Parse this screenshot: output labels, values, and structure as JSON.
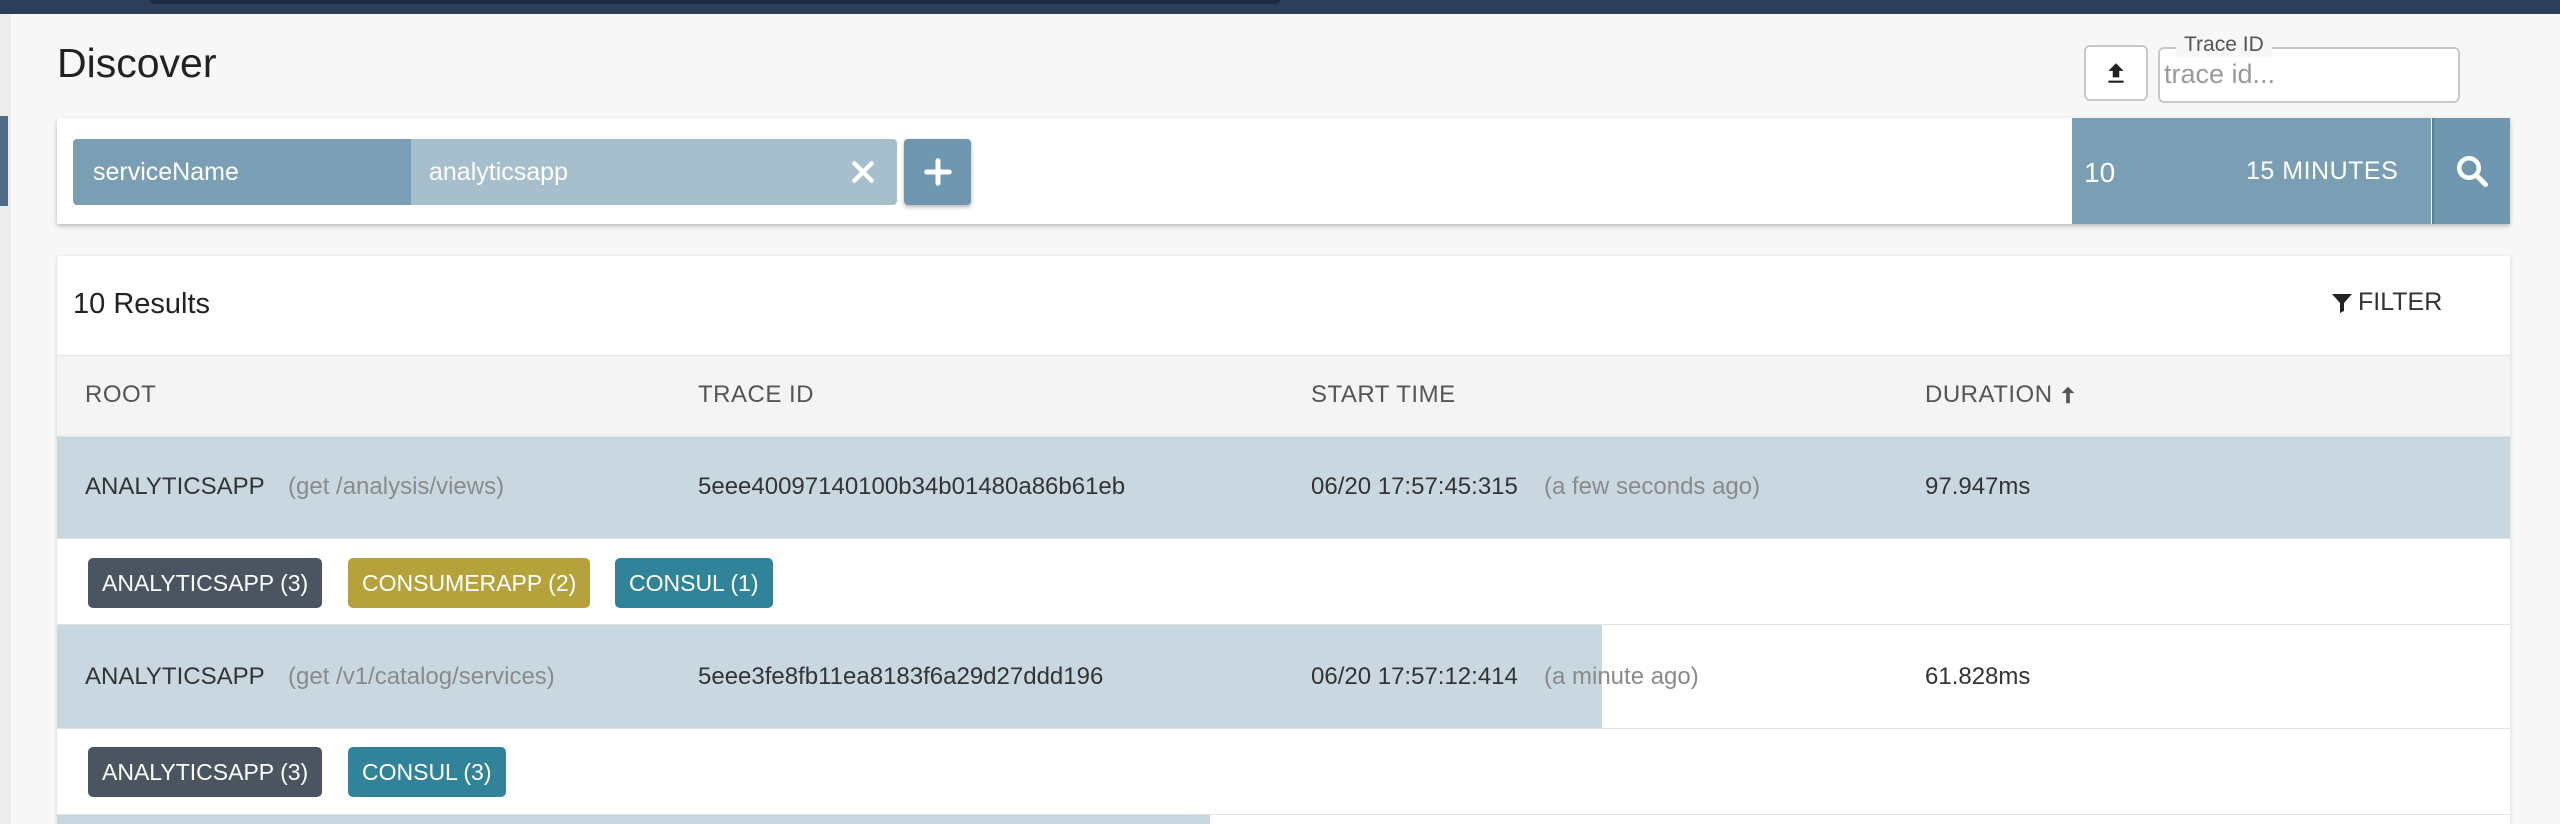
{
  "page": {
    "title": "Discover"
  },
  "trace_lookup": {
    "legend": "Trace ID",
    "placeholder": "trace id..."
  },
  "search": {
    "key": "serviceName",
    "value": "analyticsapp",
    "limit": "10",
    "lookback": "15 MINUTES"
  },
  "results": {
    "count_label": "10 Results",
    "filter_label": "FILTER",
    "columns": [
      "ROOT",
      "TRACE ID",
      "START TIME",
      "DURATION"
    ],
    "rows": [
      {
        "root": "ANALYTICSAPP",
        "op": "(get /analysis/views)",
        "trace_id": "5eee40097140100b34b01480a86b61eb",
        "start": "06/20 17:57:45:315",
        "ago": "(a few seconds ago)",
        "duration": "97.947ms",
        "duration_fraction": 1.0,
        "tags": [
          {
            "label": "ANALYTICSAPP (3)",
            "color": "#4a5561"
          },
          {
            "label": "CONSUMERAPP (2)",
            "color": "#b5a23a"
          },
          {
            "label": "CONSUL (1)",
            "color": "#31839a"
          }
        ]
      },
      {
        "root": "ANALYTICSAPP",
        "op": "(get /v1/catalog/services)",
        "trace_id": "5eee3fe8fb11ea8183f6a29d27ddd196",
        "start": "06/20 17:57:12:414",
        "ago": "(a minute ago)",
        "duration": "61.828ms",
        "duration_fraction": 0.63,
        "tags": [
          {
            "label": "ANALYTICSAPP (3)",
            "color": "#4a5561"
          },
          {
            "label": "CONSUL (3)",
            "color": "#31839a"
          }
        ]
      }
    ],
    "next_row_duration_fraction": 0.47
  }
}
